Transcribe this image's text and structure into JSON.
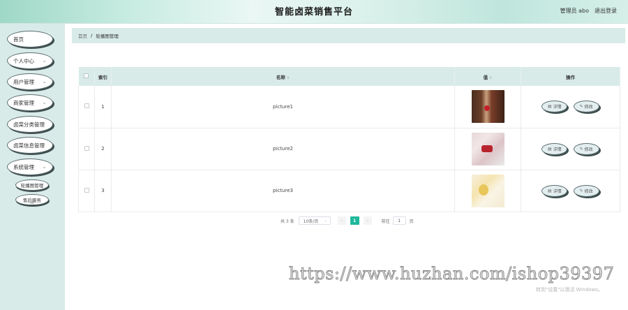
{
  "header": {
    "title": "智能卤菜销售平台",
    "admin_label": "管理员 abo",
    "logout_label": "退出登录"
  },
  "sidebar": {
    "items": [
      {
        "label": "首页",
        "has_children": false
      },
      {
        "label": "个人中心",
        "has_children": true
      },
      {
        "label": "用户管理",
        "has_children": true
      },
      {
        "label": "商家管理",
        "has_children": true
      },
      {
        "label": "卤菜分类管理",
        "has_children": false
      },
      {
        "label": "卤菜信息管理",
        "has_children": false
      },
      {
        "label": "系统管理",
        "has_children": true
      }
    ],
    "subitems": [
      {
        "label": "轮播图管理"
      },
      {
        "label": "售后服务"
      }
    ]
  },
  "breadcrumb": {
    "home": "首页",
    "separator": "/",
    "current": "轮播图管理"
  },
  "table": {
    "headers": {
      "index": "索引",
      "name": "名称",
      "value": "值",
      "actions": "操作"
    },
    "rows": [
      {
        "index": "1",
        "name": "picture1",
        "image": "dessert-photo"
      },
      {
        "index": "2",
        "name": "picture2",
        "image": "gift-box-photo"
      },
      {
        "index": "3",
        "name": "picture3",
        "image": "flowers-photo"
      }
    ],
    "detail_label": "详情",
    "edit_label": "修改"
  },
  "pagination": {
    "total": "共 3 条",
    "page_size": "10条/页",
    "current_page": "1",
    "goto_label": "前往",
    "goto_value": "1",
    "page_suffix": "页"
  },
  "overlay": {
    "watermark": "https://www.huzhan.com/ishop39397",
    "activate": "转到\"设置\"以激活 Windows。"
  },
  "colors": {
    "accent": "#1fb89b",
    "sidebar_bg": "#d8ebe9",
    "header_bg": "#c6ebe1"
  }
}
